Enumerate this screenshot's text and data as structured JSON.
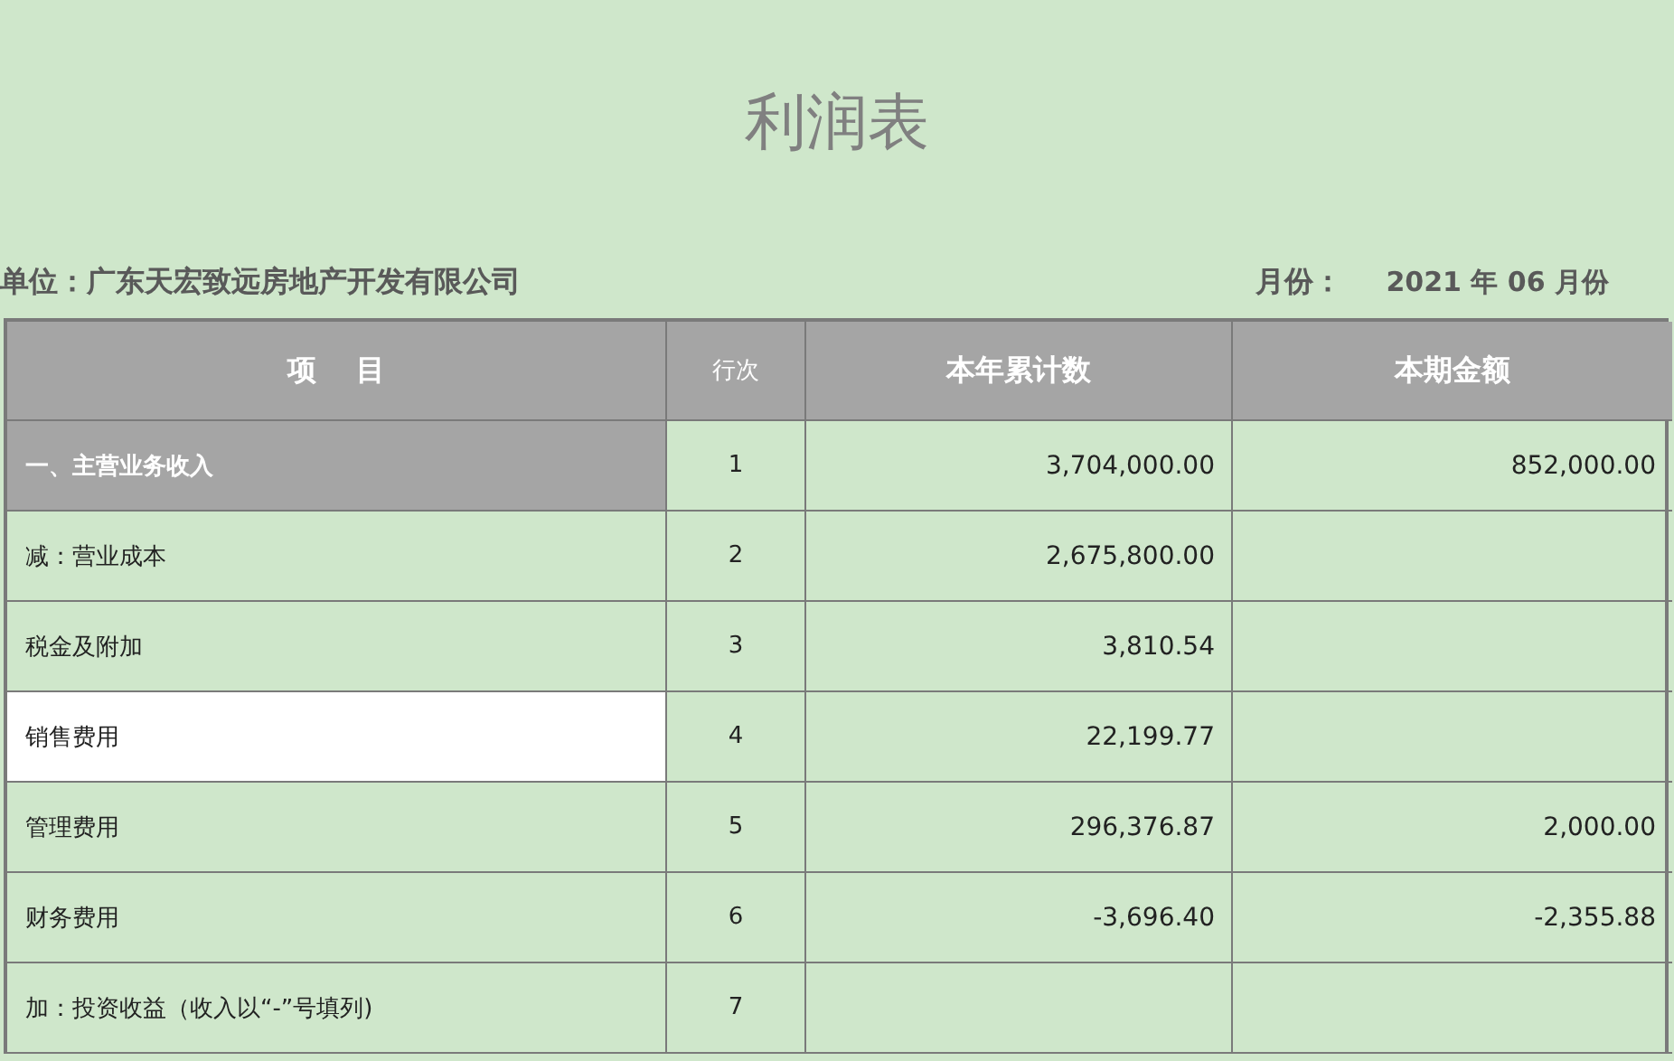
{
  "title": "利润表",
  "unit": "单位：广东天宏致远房地产开发有限公司",
  "period": {
    "label": "月份：",
    "value": "2021 年 06 月份"
  },
  "table": {
    "columns": [
      "项　 目",
      "行次",
      "本年累计数",
      "本期金额"
    ],
    "rows": [
      {
        "kind": "section",
        "item": "一、主营业务收入",
        "line": "1",
        "ytd": "3,704,000.00",
        "current": "852,000.00",
        "selected": false
      },
      {
        "kind": "normal",
        "item": "减：营业成本",
        "line": "2",
        "ytd": "2,675,800.00",
        "selected": false
      },
      {
        "kind": "normal",
        "item": "税金及附加",
        "line": "3",
        "ytd": "3,810.54",
        "selected": false
      },
      {
        "kind": "normal",
        "item": "销售费用",
        "line": "4",
        "ytd": "22,199.77",
        "selected": true
      },
      {
        "kind": "normal",
        "item": "管理费用",
        "line": "5",
        "ytd": "296,376.87",
        "current": "2,000.00",
        "selected": false
      },
      {
        "kind": "normal",
        "item": "财务费用",
        "line": "6",
        "ytd": "-3,696.40",
        "current": "-2,355.88",
        "selected": false
      },
      {
        "kind": "normal",
        "item": "加：投资收益（收入以“-”号填列)",
        "line": "7",
        "selected": false
      }
    ]
  }
}
